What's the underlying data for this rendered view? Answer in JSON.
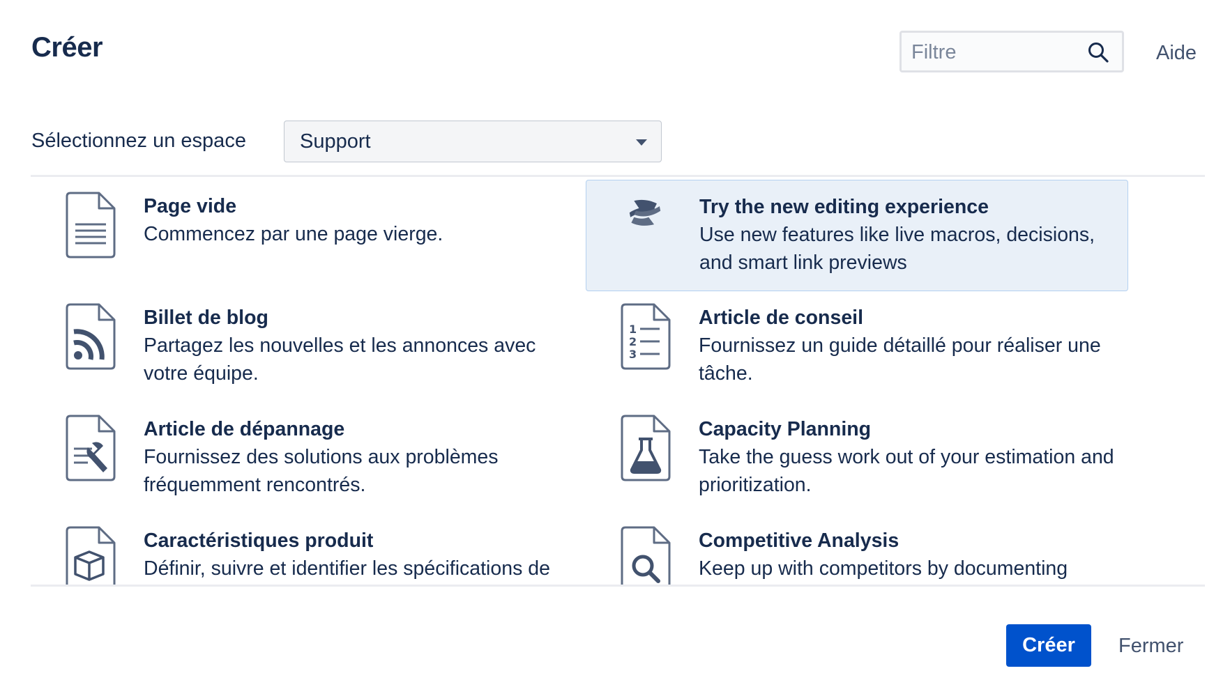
{
  "dialog": {
    "title": "Créer"
  },
  "header": {
    "filter_placeholder": "Filtre",
    "help_label": "Aide"
  },
  "space": {
    "label": "Sélectionnez un espace",
    "selected": "Support"
  },
  "templates": [
    {
      "name": "Page vide",
      "description": "Commencez par une page vierge.",
      "icon": "blank-page-icon"
    },
    {
      "name": "Try the new editing experience",
      "description": "Use new features like live macros, decisions, and smart link previews",
      "icon": "confluence-logo-icon",
      "selected": true
    },
    {
      "name": "Billet de blog",
      "description": "Partagez les nouvelles et les annonces avec votre équipe.",
      "icon": "rss-feed-icon"
    },
    {
      "name": "Article de conseil",
      "description": "Fournissez un guide détaillé pour réaliser une tâche.",
      "icon": "numbered-list-icon"
    },
    {
      "name": "Article de dépannage",
      "description": "Fournissez des solutions aux problèmes fréquemment rencontrés.",
      "icon": "wrench-icon"
    },
    {
      "name": "Capacity Planning",
      "description": "Take the guess work out of your estimation and prioritization.",
      "icon": "flask-icon"
    },
    {
      "name": "Caractéristiques produit",
      "description": "Définir, suivre et identifier les spécifications de",
      "icon": "package-icon"
    },
    {
      "name": "Competitive Analysis",
      "description": "Keep up with competitors by documenting",
      "icon": "magnifier-icon"
    }
  ],
  "footer": {
    "create_label": "Créer",
    "close_label": "Fermer"
  },
  "colors": {
    "primary": "#0052cc",
    "selected_bg": "#e9f0f8",
    "text": "#172b4d"
  }
}
